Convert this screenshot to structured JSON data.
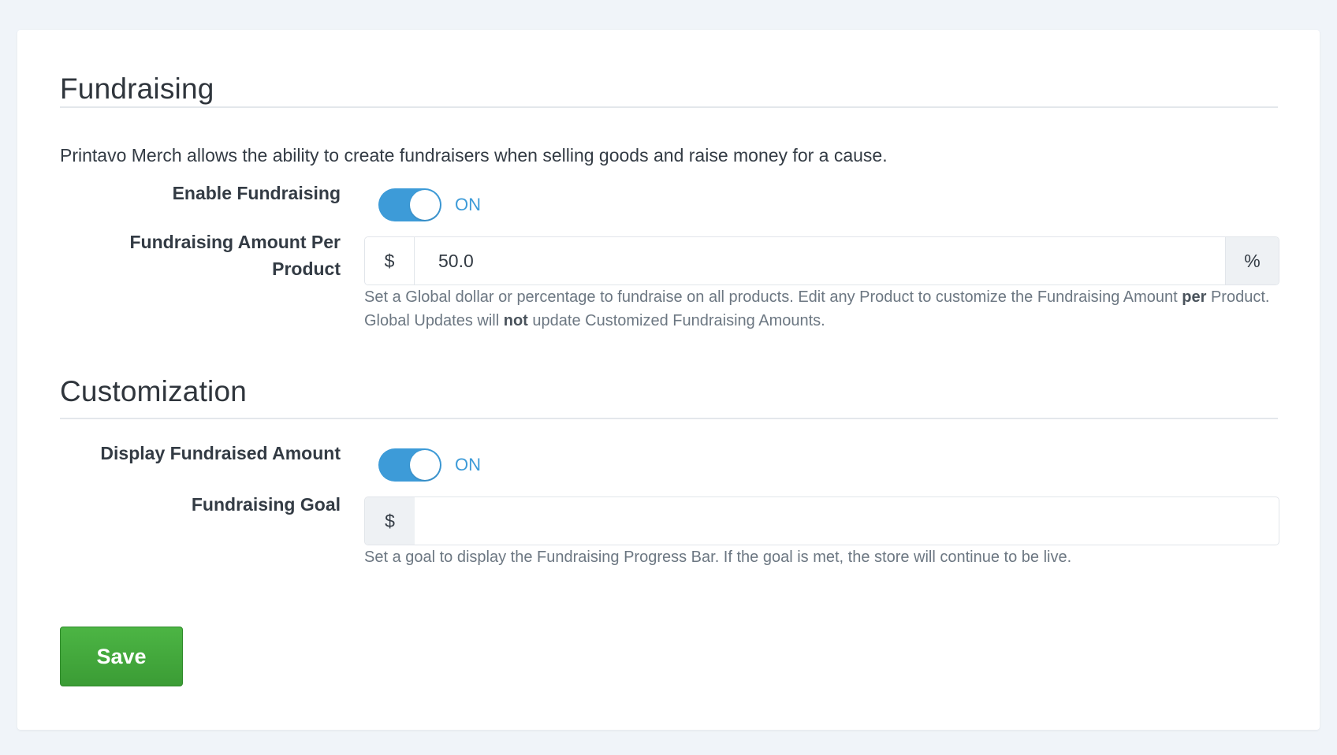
{
  "fundraising": {
    "title": "Fundraising",
    "intro": "Printavo Merch allows the ability to create fundraisers when selling goods and raise money for a cause.",
    "enable_label": "Enable Fundraising",
    "enable_state": "ON",
    "amount_label_line1": "Fundraising Amount Per",
    "amount_label_line2": "Product",
    "amount_prefix": "$",
    "amount_value": "50.0",
    "amount_suffix": "%",
    "amount_help": {
      "part1": "Set a Global dollar or percentage to fundraise on all products. Edit any Product to customize the Fundraising Amount ",
      "bold1": "per",
      "part2": " Product. Global Updates will ",
      "bold2": "not",
      "part3": " update Customized Fundraising Amounts."
    }
  },
  "customization": {
    "title": "Customization",
    "display_label": "Display Fundraised Amount",
    "display_state": "ON",
    "goal_label": "Fundraising Goal",
    "goal_prefix": "$",
    "goal_value": "",
    "goal_help": "Set a goal to display the Fundraising Progress Bar. If the goal is met, the store will continue to be live."
  },
  "actions": {
    "save_label": "Save"
  },
  "colors": {
    "accent": "#3d9bd8",
    "save_green": "#43a83c",
    "page_bg": "#f0f4f9"
  }
}
